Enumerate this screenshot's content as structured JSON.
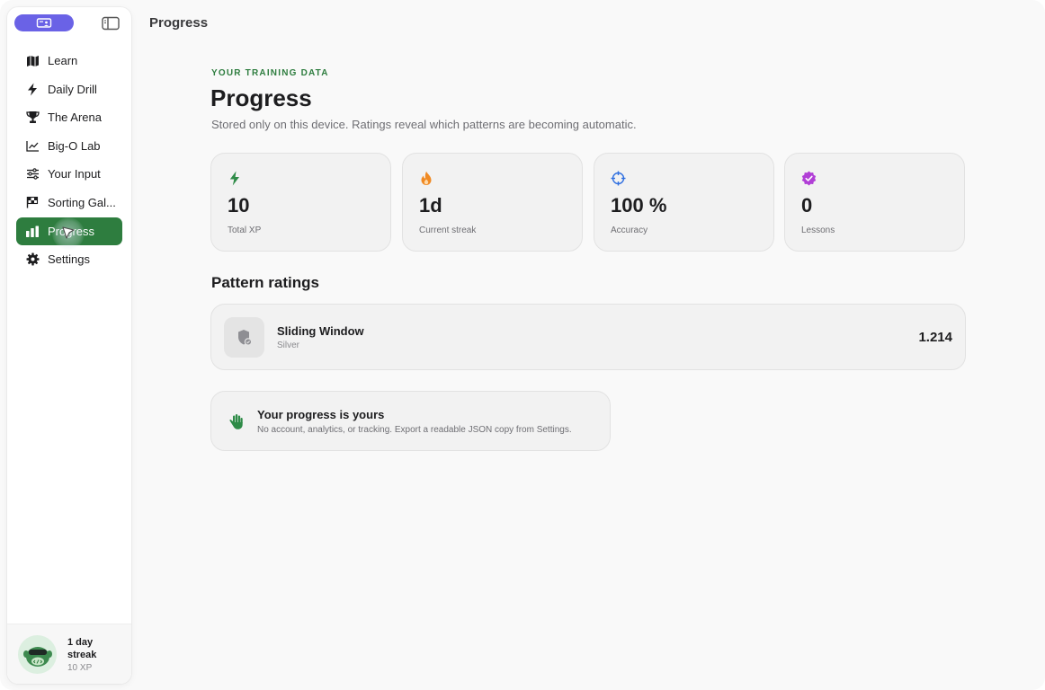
{
  "header": {
    "title": "Progress"
  },
  "sidebar": {
    "items": [
      {
        "label": "Learn",
        "icon": "map-icon"
      },
      {
        "label": "Daily Drill",
        "icon": "bolt-icon"
      },
      {
        "label": "The Arena",
        "icon": "trophy-icon"
      },
      {
        "label": "Big-O Lab",
        "icon": "chart-line-icon"
      },
      {
        "label": "Your Input",
        "icon": "sliders-icon"
      },
      {
        "label": "Sorting Gal...",
        "icon": "flag-checkered-icon"
      },
      {
        "label": "Progress",
        "icon": "bar-chart-icon",
        "active": true
      },
      {
        "label": "Settings",
        "icon": "gear-icon"
      }
    ],
    "footer": {
      "streak": "1 day streak",
      "xp": "10 XP"
    }
  },
  "main": {
    "eyebrow": "YOUR TRAINING DATA",
    "title": "Progress",
    "subtitle": "Stored only on this device. Ratings reveal which patterns are becoming automatic.",
    "stats": [
      {
        "value": "10",
        "label": "Total XP",
        "icon": "bolt-icon",
        "color": "#2e8b47"
      },
      {
        "value": "1d",
        "label": "Current streak",
        "icon": "flame-icon",
        "color": "#f08a24"
      },
      {
        "value": "100 %",
        "label": "Accuracy",
        "icon": "crosshair-icon",
        "color": "#2f6fe0"
      },
      {
        "value": "0",
        "label": "Lessons",
        "icon": "verified-badge-icon",
        "color": "#b13fd6"
      }
    ],
    "section_title": "Pattern ratings",
    "ratings": [
      {
        "name": "Sliding Window",
        "tier": "Silver",
        "value": "1.214"
      }
    ],
    "privacy": {
      "title": "Your progress is yours",
      "text": "No account, analytics, or tracking. Export a readable JSON copy from Settings."
    }
  },
  "colors": {
    "accent": "#2e7d3f",
    "brand": "#6a62e6"
  }
}
